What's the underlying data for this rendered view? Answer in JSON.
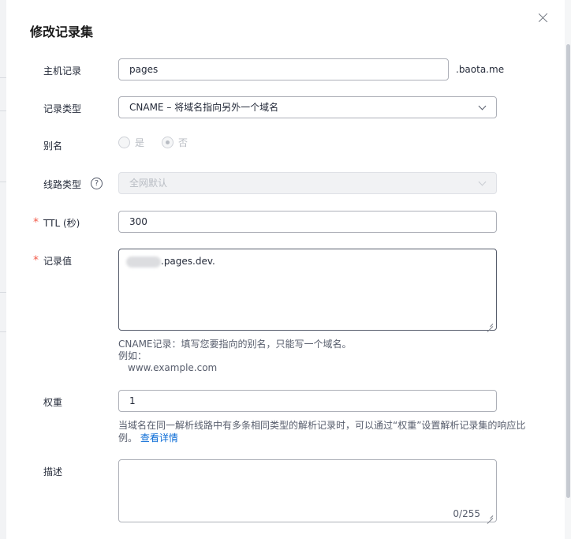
{
  "dialog": {
    "title": "修改记录集"
  },
  "form": {
    "host_record": {
      "label": "主机记录",
      "value": "pages",
      "suffix": ".baota.me"
    },
    "record_type": {
      "label": "记录类型",
      "value": "CNAME – 将域名指向另外一个域名"
    },
    "alias": {
      "label": "别名",
      "options": [
        "是",
        "否"
      ],
      "selected": "否"
    },
    "line_type": {
      "label": "线路类型",
      "help_glyph": "?",
      "value": "全网默认"
    },
    "ttl": {
      "required_mark": "*",
      "label": "TTL (秒)",
      "value": "300"
    },
    "record_value": {
      "required_mark": "*",
      "label": "记录值",
      "value_suffix": ".pages.dev.",
      "hint_line1": "CNAME记录：填写您要指向的别名，只能写一个域名。",
      "hint_line2": "例如：",
      "hint_line3": "www.example.com"
    },
    "weight": {
      "label": "权重",
      "value": "1",
      "hint_line1": "当域名在同一解析线路中有多条相同类型的解析记录时，可以通过“权重”设置解析记录集的响应比",
      "hint_line2": "例。",
      "hint_link": "查看详情"
    },
    "description": {
      "label": "描述",
      "counter": "0/255"
    }
  },
  "icons": {
    "close": "close-icon",
    "dropdown": "chevron-down-icon",
    "help": "help-circle-icon",
    "resize": "resize-grip-icon"
  },
  "colors": {
    "required": "#f25a4a",
    "link": "#0a6bd6",
    "border": "#adb0b8",
    "disabled_bg": "#f1f2f4"
  }
}
